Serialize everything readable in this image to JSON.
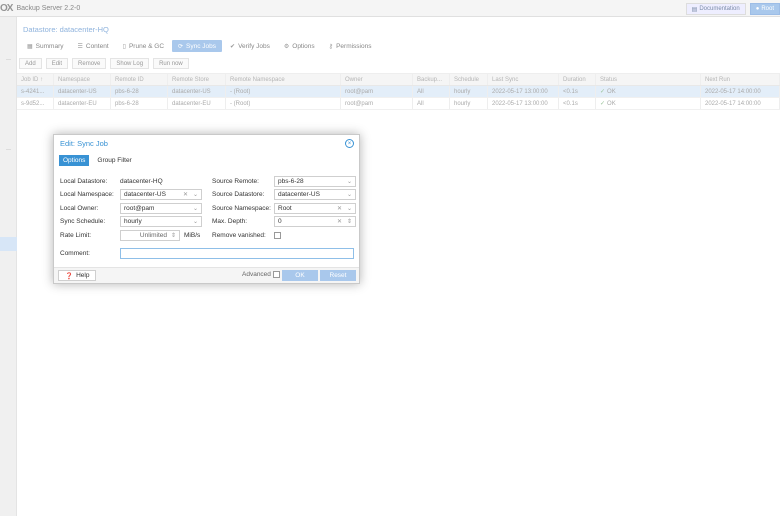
{
  "app": {
    "logo": "OX",
    "title": "Backup Server 2.2-0",
    "documentation": "Documentation",
    "user_button": "Root"
  },
  "datastore_title": "Datastore: datacenter-HQ",
  "tabs": [
    {
      "label": "Summary",
      "icon": "summary-icon",
      "glyph": "▦"
    },
    {
      "label": "Content",
      "icon": "content-icon",
      "glyph": "☰"
    },
    {
      "label": "Prune & GC",
      "icon": "trash-icon",
      "glyph": "🗑"
    },
    {
      "label": "Sync Jobs",
      "icon": "sync-icon",
      "glyph": "⟳"
    },
    {
      "label": "Verify Jobs",
      "icon": "verify-icon",
      "glyph": "✔"
    },
    {
      "label": "Options",
      "icon": "gear-icon",
      "glyph": "⚙"
    },
    {
      "label": "Permissions",
      "icon": "key-icon",
      "glyph": "⚿"
    }
  ],
  "toolbar": {
    "add": "Add",
    "edit": "Edit",
    "remove": "Remove",
    "show_log": "Show Log",
    "run_now": "Run now"
  },
  "grid": {
    "headers": [
      "Job ID ↑",
      "Namespace",
      "Remote ID",
      "Remote Store",
      "Remote Namespace",
      "Owner",
      "Backup...",
      "Schedule",
      "Last Sync",
      "Duration",
      "Status",
      "Next Run"
    ],
    "rows": [
      [
        "s-4241...",
        "datacenter-US",
        "pbs-6-28",
        "datacenter-US",
        "- (Root)",
        "root@pam",
        "All",
        "hourly",
        "2022-05-17 13:00:00",
        "<0.1s",
        "OK",
        "2022-05-17 14:00:00"
      ],
      [
        "s-9d52...",
        "datacenter-EU",
        "pbs-6-28",
        "datacenter-EU",
        "- (Root)",
        "root@pam",
        "All",
        "hourly",
        "2022-05-17 13:00:00",
        "<0.1s",
        "OK",
        "2022-05-17 14:00:00"
      ]
    ]
  },
  "dialog": {
    "title": "Edit: Sync Job",
    "tab_options": "Options",
    "tab_group_filter": "Group Filter",
    "local_datastore_label": "Local Datastore:",
    "local_datastore_value": "datacenter-HQ",
    "local_namespace_label": "Local Namespace:",
    "local_namespace_value": "datacenter-US",
    "local_owner_label": "Local Owner:",
    "local_owner_value": "root@pam",
    "sync_schedule_label": "Sync Schedule:",
    "sync_schedule_value": "hourly",
    "rate_limit_label": "Rate Limit:",
    "rate_limit_value": "Unlimited",
    "rate_limit_unit": "MiB/s",
    "source_remote_label": "Source Remote:",
    "source_remote_value": "pbs-6-28",
    "source_datastore_label": "Source Datastore:",
    "source_datastore_value": "datacenter-US",
    "source_namespace_label": "Source Namespace:",
    "source_namespace_value": "Root",
    "max_depth_label": "Max. Depth:",
    "max_depth_value": "0",
    "remove_vanished_label": "Remove vanished:",
    "comment_label": "Comment:",
    "comment_value": "",
    "help": "Help",
    "advanced": "Advanced",
    "ok": "OK",
    "reset": "Reset"
  }
}
